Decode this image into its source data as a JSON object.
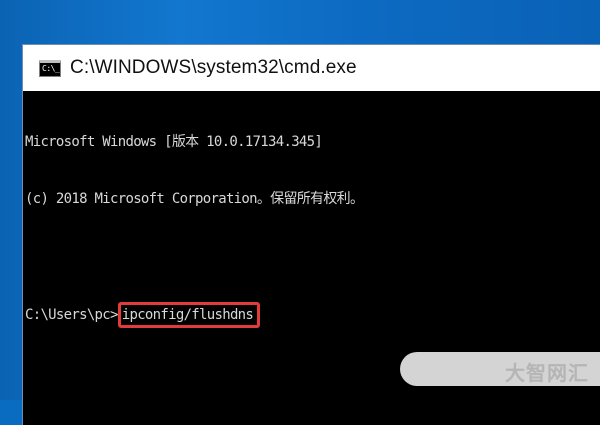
{
  "window": {
    "title": "C:\\WINDOWS\\system32\\cmd.exe",
    "icon": "cmd-icon",
    "icon_glyph": "C:\\_"
  },
  "console": {
    "lines": [
      "Microsoft Windows [版本 10.0.17134.345]",
      "(c) 2018 Microsoft Corporation。保留所有权利。"
    ],
    "prompt": "C:\\Users\\pc>",
    "command": "ipconfig/flushdns"
  },
  "highlight_color": "#e23b3b",
  "watermark": {
    "text": "大智网汇"
  }
}
